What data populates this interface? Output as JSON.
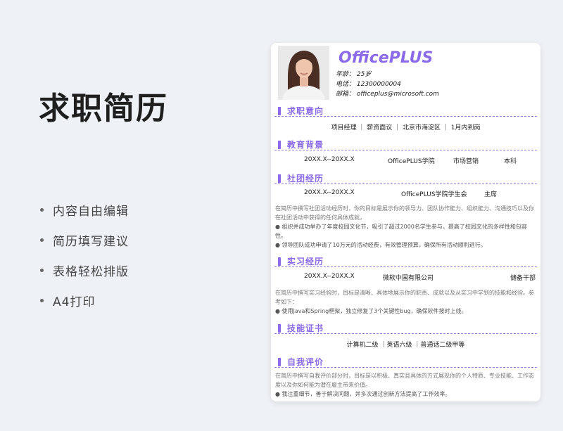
{
  "left": {
    "title": "求职简历",
    "features": [
      "内容自由编辑",
      "简历填写建议",
      "表格轻松排版",
      "A4打印"
    ]
  },
  "resume": {
    "brand": "OfficePLUS",
    "age": "年龄： 25岁",
    "phone": "电话： 12300000004",
    "email": "邮箱： officeplus@microsoft.com",
    "sections": {
      "intention": {
        "title": "求职意向",
        "line": "项目经理 ｜ 薪资面议 ｜ 北京市海淀区 ｜ 1月内到岗"
      },
      "education": {
        "title": "教育背景",
        "date": "20XX.X--20XX.X",
        "school": "OfficePLUS学院",
        "major": "市场营销",
        "degree": "本科"
      },
      "club": {
        "title": "社团经历",
        "date": "20XX.X--20XX.X",
        "org": "OfficePLUS学院学生会",
        "role": "主席",
        "desc": "在简历中撰写社团活动经历时，你的目标是展示你的领导力、团队协作能力、组织能力、沟通技巧以及你在社团活动中获得的任何具体成就。",
        "bullet1": "● 组织并成功举办了年度校园文化节，吸引了超过2000名学生参与，提高了校园文化的多样性和包容性。",
        "bullet2": "● 领导团队成功申请了10万元的活动经费，有效管理预算，确保所有活动顺利进行。"
      },
      "internship": {
        "title": "实习经历",
        "date": "20XX.X--20XX.X",
        "company": "微软中国有限公司",
        "role": "储备干部",
        "desc": "在简历中撰写实习经验时，目标是清晰、具体地展示你的职责、成就以及从实习中学到的技能和经验。参考如下：",
        "bullet1": "● 使用Java和Spring框架，独立修复了3个关键性bug，确保软件按时上线。"
      },
      "skills": {
        "title": "技能证书",
        "line": "计算机二级 ｜英语六级 ｜普通话二级甲等"
      },
      "self": {
        "title": "自我评价",
        "desc": "在简历中撰写自我评价部分时，目标是以积极、真实且具体的方式展现你的个人特质、专业技能、工作态度以及你如何能为潜在雇主带来价值。",
        "bullet1": "● 我注重细节，善于解决问题，并多次通过创新方法提高了工作效率。"
      }
    }
  },
  "colors": {
    "accent": "#8a6ae8",
    "background": "#eef1f5",
    "card": "#ffffff"
  },
  "icons": {
    "feature_bullet": "dot"
  }
}
